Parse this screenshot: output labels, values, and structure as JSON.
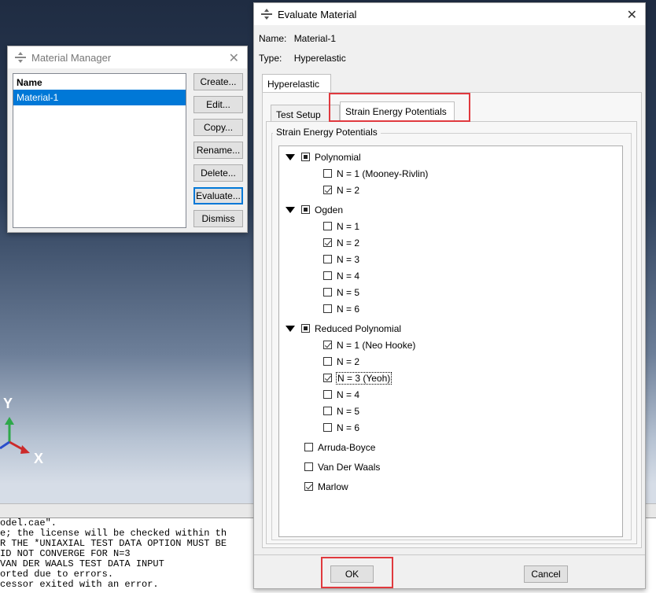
{
  "material_manager": {
    "title": "Material Manager",
    "list_header": "Name",
    "items": [
      "Material-1"
    ],
    "buttons": {
      "create": "Create...",
      "edit": "Edit...",
      "copy": "Copy...",
      "rename": "Rename...",
      "delete": "Delete...",
      "evaluate": "Evaluate...",
      "dismiss": "Dismiss"
    }
  },
  "evaluate_dialog": {
    "title": "Evaluate Material",
    "name_label": "Name:",
    "name_value": "Material-1",
    "type_label": "Type:",
    "type_value": "Hyperelastic",
    "outer_tab": "Hyperelastic",
    "tabs": {
      "test_setup": "Test Setup",
      "strain_energy": "Strain Energy Potentials"
    },
    "group_title": "Strain Energy Potentials",
    "polynomial": {
      "label": "Polynomial",
      "items": [
        {
          "label": "N = 1 (Mooney-Rivlin)",
          "checked": false
        },
        {
          "label": "N = 2",
          "checked": true
        }
      ]
    },
    "ogden": {
      "label": "Ogden",
      "items": [
        {
          "label": "N = 1",
          "checked": false
        },
        {
          "label": "N = 2",
          "checked": true
        },
        {
          "label": "N = 3",
          "checked": false
        },
        {
          "label": "N = 4",
          "checked": false
        },
        {
          "label": "N = 5",
          "checked": false
        },
        {
          "label": "N = 6",
          "checked": false
        }
      ]
    },
    "reduced_polynomial": {
      "label": "Reduced Polynomial",
      "items": [
        {
          "label": "N = 1 (Neo Hooke)",
          "checked": true
        },
        {
          "label": "N = 2",
          "checked": false
        },
        {
          "label": "N = 3 (Yeoh)",
          "checked": true
        },
        {
          "label": "N = 4",
          "checked": false
        },
        {
          "label": "N = 5",
          "checked": false
        },
        {
          "label": "N = 6",
          "checked": false
        }
      ]
    },
    "arruda_boyce": {
      "label": "Arruda-Boyce",
      "checked": false
    },
    "van_der_waals": {
      "label": "Van Der Waals",
      "checked": false
    },
    "marlow": {
      "label": "Marlow",
      "checked": true
    },
    "ok": "OK",
    "cancel": "Cancel"
  },
  "viewport": {
    "axis_y": "Y",
    "axis_x": "X"
  },
  "messages": [
    "odel.cae\".",
    "e; the license will be checked within th",
    "R THE *UNIAXIAL TEST DATA OPTION MUST BE",
    "ID NOT CONVERGE FOR N=3",
    "VAN DER WAALS TEST DATA INPUT",
    "orted due to errors.",
    "cessor exited with an error."
  ],
  "colors": {
    "selection": "#0078d7",
    "highlight_box": "#e0393e",
    "axis_x": "#cc2a2a",
    "axis_y": "#2ea84a",
    "axis_z": "#2a4fcc"
  }
}
